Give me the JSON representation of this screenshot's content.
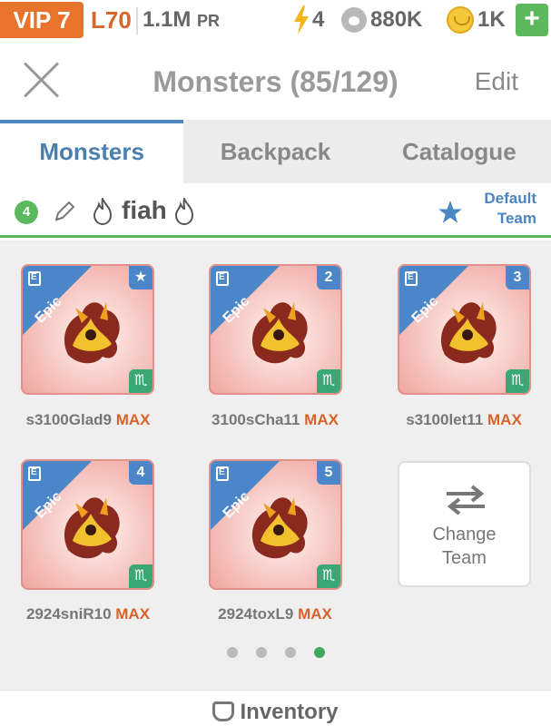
{
  "status_bar": {
    "vip": "VIP 7",
    "level": "L70",
    "power": "1.1M",
    "power_unit": "PR",
    "energy": "4",
    "food": "880K",
    "coins": "1K",
    "add_label": "+"
  },
  "header": {
    "title": "Monsters (85/129)",
    "edit_label": "Edit"
  },
  "tabs": [
    {
      "label": "Monsters",
      "active": true
    },
    {
      "label": "Backpack",
      "active": false
    },
    {
      "label": "Catalogue",
      "active": false
    }
  ],
  "team": {
    "number": "4",
    "name": "fiah",
    "default_label_1": "Default",
    "default_label_2": "Team"
  },
  "monsters": [
    {
      "rarity": "Epic",
      "slot": "★",
      "name": "s3100Glad9",
      "level": "MAX"
    },
    {
      "rarity": "Epic",
      "slot": "2",
      "name": "3100sCha11",
      "level": "MAX"
    },
    {
      "rarity": "Epic",
      "slot": "3",
      "name": "s3100let11",
      "level": "MAX"
    },
    {
      "rarity": "Epic",
      "slot": "4",
      "name": "2924sniR10",
      "level": "MAX"
    },
    {
      "rarity": "Epic",
      "slot": "5",
      "name": "2924toxL9",
      "level": "MAX"
    }
  ],
  "change_team": {
    "line1": "Change",
    "line2": "Team"
  },
  "pagination": {
    "total": 4,
    "active_index": 3
  },
  "footer": {
    "label": "Inventory"
  },
  "colors": {
    "vip": "#e8742c",
    "accent_blue": "#4a86c0",
    "green": "#5cb85c",
    "max_text": "#d9622a",
    "epic_band": "#e05a57"
  }
}
